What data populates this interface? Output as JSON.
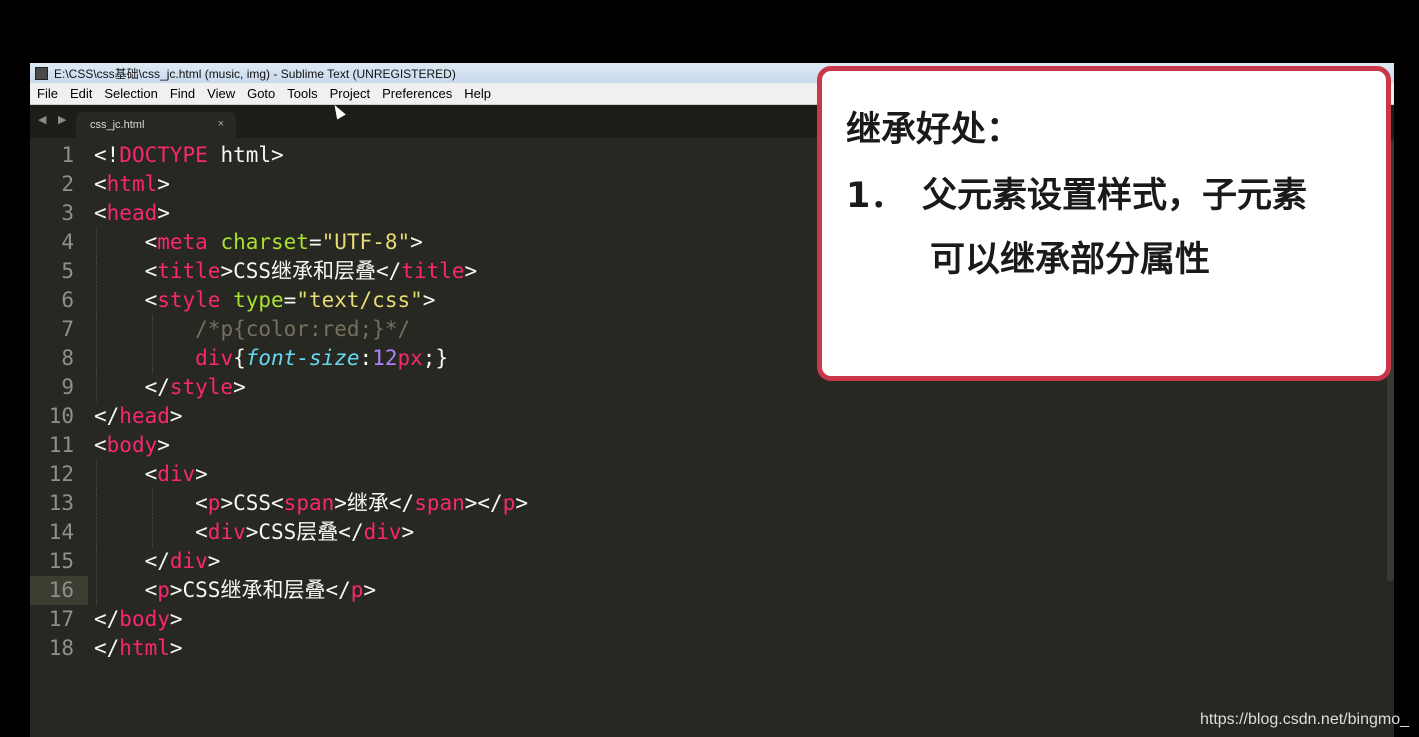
{
  "window": {
    "title": "E:\\CSS\\css基础\\css_jc.html (music, img) - Sublime Text (UNREGISTERED)"
  },
  "menu": [
    "File",
    "Edit",
    "Selection",
    "Find",
    "View",
    "Goto",
    "Tools",
    "Project",
    "Preferences",
    "Help"
  ],
  "tabbar": {
    "nav": "◀ ▶",
    "tab_label": "css_jc.html",
    "tab_close": "×"
  },
  "editor": {
    "current_line": 16,
    "line_numbers": [
      "1",
      "2",
      "3",
      "4",
      "5",
      "6",
      "7",
      "8",
      "9",
      "10",
      "11",
      "12",
      "13",
      "14",
      "15",
      "16",
      "17",
      "18"
    ]
  },
  "callout": {
    "title": "继承好处：",
    "item_number": "1．",
    "line1": "父元素设置样式，子元素",
    "line2": "可以继承部分属性"
  },
  "watermark": "https://blog.csdn.net/bingmo_",
  "colors": {
    "editor_bg": "#272822",
    "tag": "#f92672",
    "attribute": "#a6e22e",
    "string": "#e6db74",
    "comment": "#75715e",
    "number": "#ae81ff",
    "property": "#66d9ef",
    "callout_border": "#c9374b"
  }
}
